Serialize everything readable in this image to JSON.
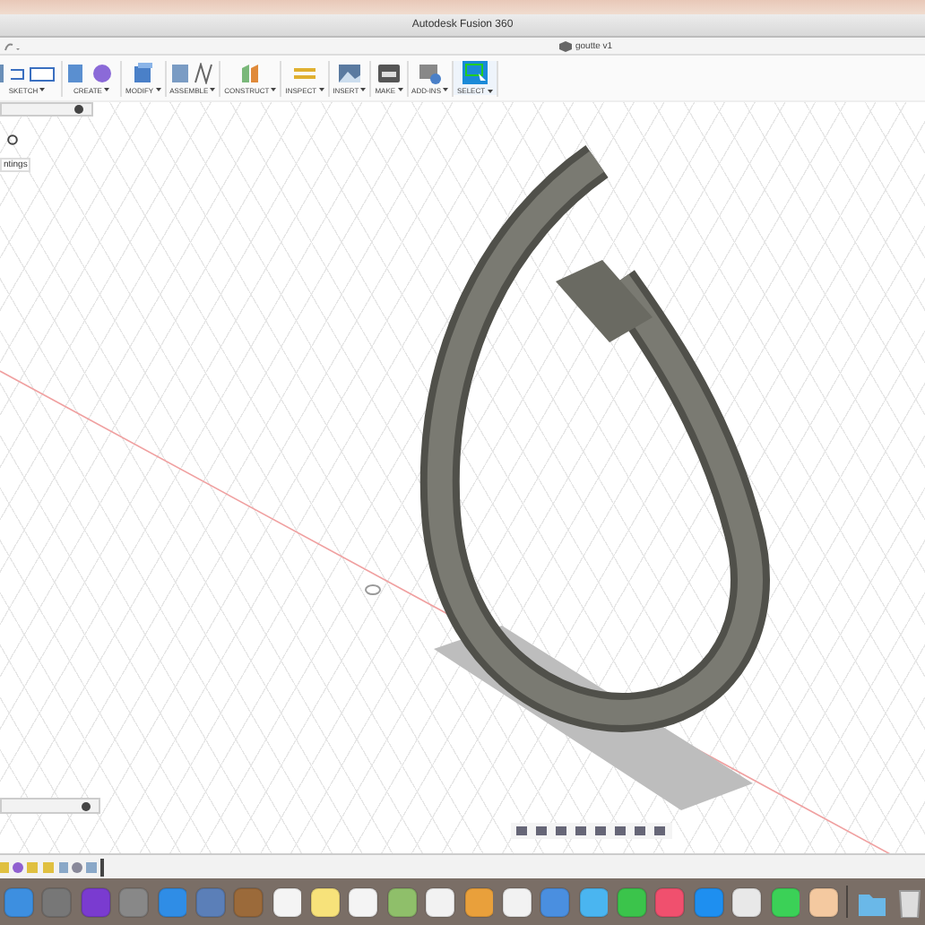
{
  "window": {
    "title": "Autodesk Fusion 360"
  },
  "document_tab": {
    "label": "goutte v1"
  },
  "toolbar": [
    {
      "label": "SKETCH",
      "kind": "sketch",
      "selected": false
    },
    {
      "label": "CREATE",
      "kind": "create",
      "selected": false
    },
    {
      "label": "MODIFY",
      "kind": "modify",
      "selected": false
    },
    {
      "label": "ASSEMBLE",
      "kind": "assemble",
      "selected": false
    },
    {
      "label": "CONSTRUCT",
      "kind": "construct",
      "selected": false
    },
    {
      "label": "INSPECT",
      "kind": "inspect",
      "selected": false
    },
    {
      "label": "INSERT",
      "kind": "insert",
      "selected": false
    },
    {
      "label": "MAKE",
      "kind": "make",
      "selected": false
    },
    {
      "label": "ADD-INS",
      "kind": "addins",
      "selected": false
    },
    {
      "label": "SELECT",
      "kind": "select",
      "selected": true
    }
  ],
  "browser": {
    "item": "ntings"
  }
}
